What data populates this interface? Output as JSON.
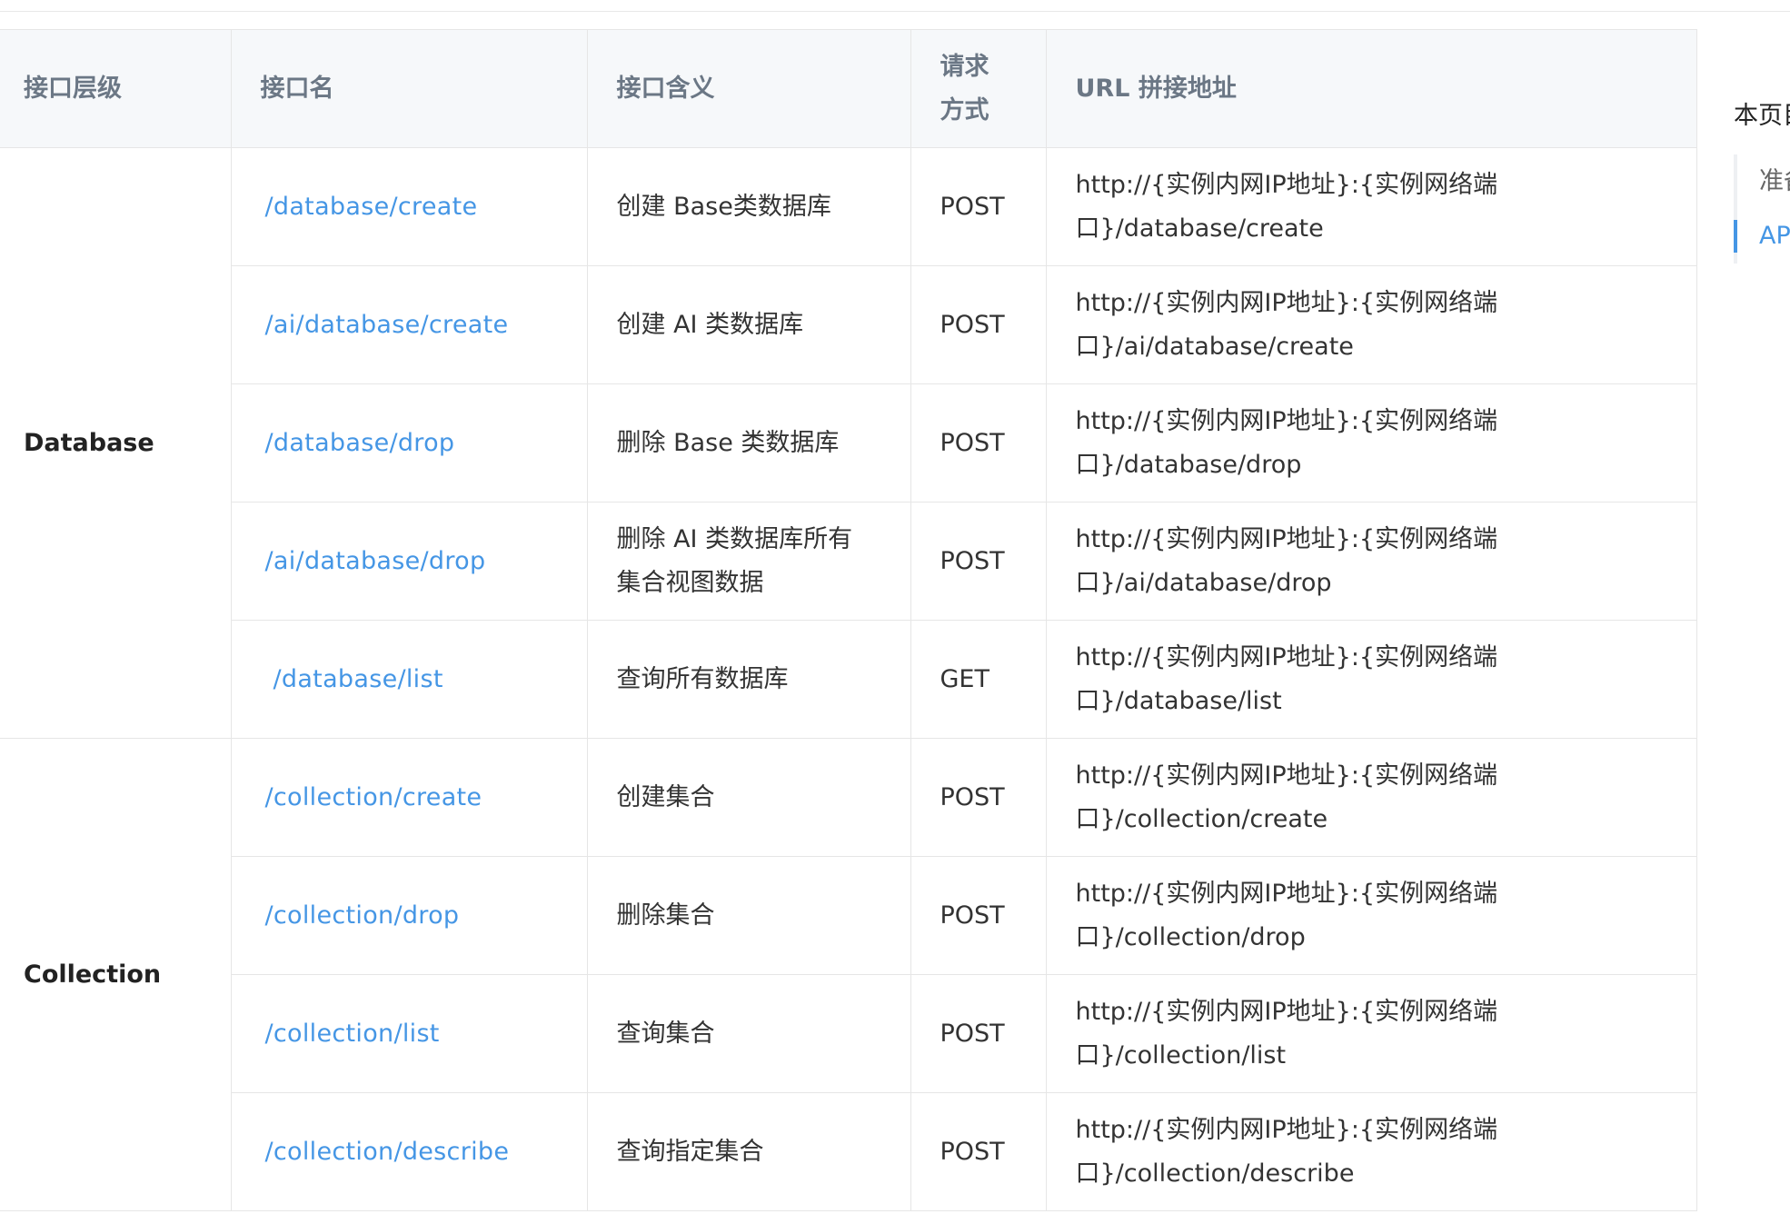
{
  "table": {
    "headers": {
      "level": "接口层级",
      "name": "接口名",
      "meaning": "接口含义",
      "method": "请求\n方式",
      "url": "URL 拼接地址"
    },
    "groups": [
      {
        "level": "Database",
        "rows": [
          {
            "name": "/database/create",
            "meaning": "创建 Base类数据库",
            "method": "POST",
            "url": "http://{实例内网IP地址}:{实例网络端\n口}/database/create"
          },
          {
            "name": "/ai/database/create",
            "meaning": "创建 AI 类数据库",
            "method": "POST",
            "url": "http://{实例内网IP地址}:{实例网络端\n口}/ai/database/create"
          },
          {
            "name": "/database/drop",
            "meaning": "删除 Base 类数据库",
            "method": "POST",
            "url": "http://{实例内网IP地址}:{实例网络端\n口}/database/drop"
          },
          {
            "name": "/ai/database/drop",
            "meaning": "删除 AI 类数据库所有\n集合视图数据",
            "method": "POST",
            "url": "http://{实例内网IP地址}:{实例网络端\n口}/ai/database/drop"
          },
          {
            "name": "/database/list",
            "meaning": "查询所有数据库",
            "method": "GET",
            "url": "http://{实例内网IP地址}:{实例网络端\n口}/database/list"
          }
        ]
      },
      {
        "level": "Collection",
        "rows": [
          {
            "name": "/collection/create",
            "meaning": "创建集合",
            "method": "POST",
            "url": "http://{实例内网IP地址}:{实例网络端\n口}/collection/create"
          },
          {
            "name": "/collection/drop",
            "meaning": "删除集合",
            "method": "POST",
            "url": "http://{实例内网IP地址}:{实例网络端\n口}/collection/drop"
          },
          {
            "name": "/collection/list",
            "meaning": "查询集合",
            "method": "POST",
            "url": "http://{实例内网IP地址}:{实例网络端\n口}/collection/list"
          },
          {
            "name": "/collection/describe",
            "meaning": "查询指定集合",
            "method": "POST",
            "url": "http://{实例内网IP地址}:{实例网络端\n口}/collection/describe"
          }
        ]
      }
    ]
  },
  "toc": {
    "title": "本页目",
    "items": [
      {
        "label": "准备",
        "active": false
      },
      {
        "label": "API",
        "active": true
      }
    ]
  },
  "colors": {
    "link": "#4596e5",
    "header_bg": "#f6f8fa",
    "border": "#e6e6e6"
  }
}
